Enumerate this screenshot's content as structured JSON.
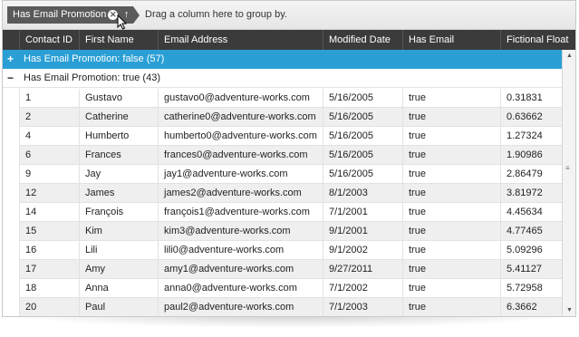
{
  "group_panel": {
    "chip_label": "Has Email Promotion",
    "chip_remove_glyph": "✕",
    "chip_sort_glyph": "↑",
    "hint": "Drag a column here to group by."
  },
  "columns": [
    "Contact ID",
    "First Name",
    "Email Address",
    "Modified Date",
    "Has Email Promotion",
    "Fictional Float"
  ],
  "groups": [
    {
      "toggle": "+",
      "label": "Has Email Promotion: false (57)"
    },
    {
      "toggle": "−",
      "label": "Has Email Promotion: true (43)"
    }
  ],
  "rows": [
    [
      "1",
      "Gustavo",
      "gustavo0@adventure-works.com",
      "5/16/2005",
      "true",
      "0.31831"
    ],
    [
      "2",
      "Catherine",
      "catherine0@adventure-works.com",
      "5/16/2005",
      "true",
      "0.63662"
    ],
    [
      "4",
      "Humberto",
      "humberto0@adventure-works.com",
      "5/16/2005",
      "true",
      "1.27324"
    ],
    [
      "6",
      "Frances",
      "frances0@adventure-works.com",
      "5/16/2005",
      "true",
      "1.90986"
    ],
    [
      "9",
      "Jay",
      "jay1@adventure-works.com",
      "5/16/2005",
      "true",
      "2.86479"
    ],
    [
      "12",
      "James",
      "james2@adventure-works.com",
      "8/1/2003",
      "true",
      "3.81972"
    ],
    [
      "14",
      "François",
      "françois1@adventure-works.com",
      "7/1/2001",
      "true",
      "4.45634"
    ],
    [
      "15",
      "Kim",
      "kim3@adventure-works.com",
      "9/1/2001",
      "true",
      "4.77465"
    ],
    [
      "16",
      "Lili",
      "lili0@adventure-works.com",
      "9/1/2002",
      "true",
      "5.09296"
    ],
    [
      "17",
      "Amy",
      "amy1@adventure-works.com",
      "9/27/2011",
      "true",
      "5.41127"
    ],
    [
      "18",
      "Anna",
      "anna0@adventure-works.com",
      "7/1/2002",
      "true",
      "5.72958"
    ],
    [
      "20",
      "Paul",
      "paul2@adventure-works.com",
      "7/1/2003",
      "true",
      "6.3662"
    ]
  ],
  "colors": {
    "header_bg": "#3b3b3b",
    "selected_group_bg": "#2a9fd6",
    "chip_bg": "#5a5a5a",
    "alt_row_bg": "#efefef"
  },
  "icons": {
    "scroll_up": "up-arrow-icon",
    "scroll_down": "down-arrow-icon",
    "scroll_grip": "grip-icon",
    "cursor": "mouse-cursor-icon"
  }
}
